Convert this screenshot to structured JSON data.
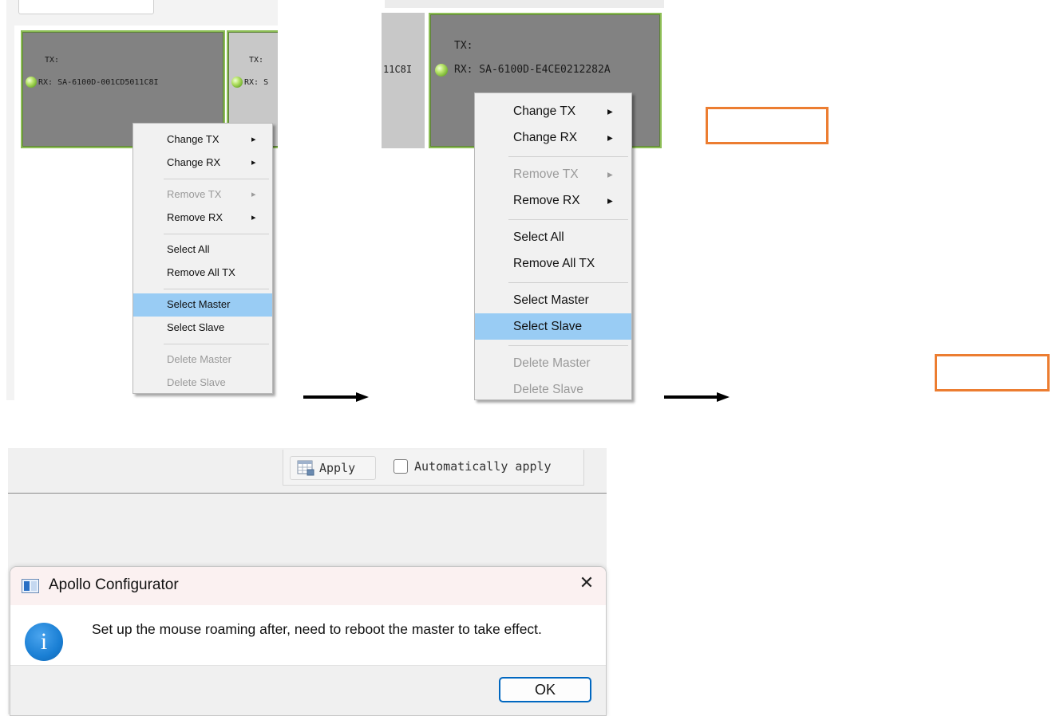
{
  "panel1": {
    "card1": {
      "tx": "TX:",
      "rx": "RX: SA-6100D-001CD5011C8I"
    },
    "card2": {
      "tx": "TX:",
      "rx": "RX: S"
    },
    "menu": {
      "items": [
        {
          "label": "Change TX",
          "arrow": "▸",
          "disabled": false,
          "highlight": false
        },
        {
          "label": "Change RX",
          "arrow": "▸",
          "disabled": false,
          "highlight": false
        },
        {
          "label": "Remove TX",
          "arrow": "▸",
          "disabled": true,
          "highlight": false
        },
        {
          "label": "Remove RX",
          "arrow": "▸",
          "disabled": false,
          "highlight": false
        },
        {
          "label": "Select All",
          "arrow": "",
          "disabled": false,
          "highlight": false
        },
        {
          "label": "Remove All TX",
          "arrow": "",
          "disabled": false,
          "highlight": false
        },
        {
          "label": "Select Master",
          "arrow": "",
          "disabled": false,
          "highlight": true
        },
        {
          "label": "Select Slave",
          "arrow": "",
          "disabled": false,
          "highlight": false
        },
        {
          "label": "Delete Master",
          "arrow": "",
          "disabled": true,
          "highlight": false
        },
        {
          "label": "Delete Slave",
          "arrow": "",
          "disabled": true,
          "highlight": false
        }
      ]
    }
  },
  "panel2": {
    "card_left": {
      "rx": "11C8I"
    },
    "card_main": {
      "tx": "TX:",
      "rx": "RX: SA-6100D-E4CE0212282A"
    },
    "menu": {
      "items": [
        {
          "label": "Change TX",
          "arrow": "▸",
          "disabled": false,
          "highlight": false
        },
        {
          "label": "Change RX",
          "arrow": "▸",
          "disabled": false,
          "highlight": false
        },
        {
          "label": "Remove TX",
          "arrow": "▸",
          "disabled": true,
          "highlight": false
        },
        {
          "label": "Remove RX",
          "arrow": "▸",
          "disabled": false,
          "highlight": false
        },
        {
          "label": "Select All",
          "arrow": "",
          "disabled": false,
          "highlight": false
        },
        {
          "label": "Remove All TX",
          "arrow": "",
          "disabled": false,
          "highlight": false
        },
        {
          "label": "Select Master",
          "arrow": "",
          "disabled": false,
          "highlight": false
        },
        {
          "label": "Select Slave",
          "arrow": "",
          "disabled": false,
          "highlight": true
        },
        {
          "label": "Delete Master",
          "arrow": "",
          "disabled": true,
          "highlight": false
        },
        {
          "label": "Delete Slave",
          "arrow": "",
          "disabled": true,
          "highlight": false
        }
      ]
    }
  },
  "toolbar": {
    "apply_label": "Apply",
    "auto_apply_label": "Automatically apply",
    "auto_apply_checked": false
  },
  "dialog": {
    "title": "Apollo Configurator",
    "message": "Set up the mouse roaming after, need to reboot the master to take effect.",
    "ok_label": "OK",
    "close_glyph": "✕",
    "info_glyph": "i"
  },
  "colors": {
    "accent_orange": "#ec7d31",
    "menu_highlight": "#99ccf4",
    "card_border": "#8cbd55",
    "info_blue": "#1a7fd4"
  }
}
